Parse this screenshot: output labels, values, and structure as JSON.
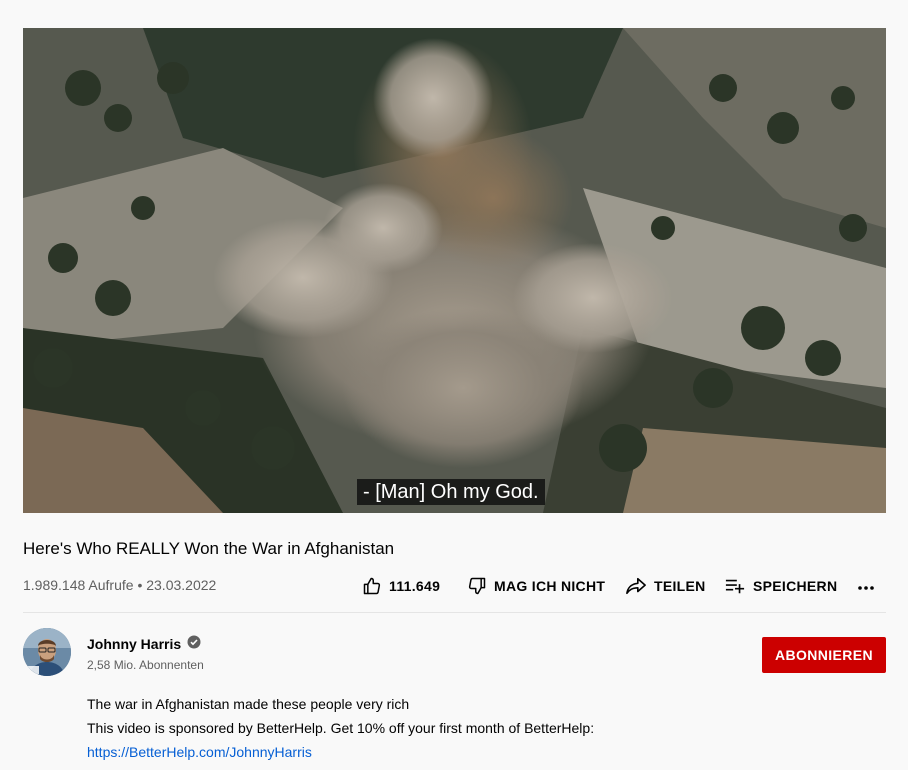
{
  "video": {
    "caption": "- [Man] Oh my God."
  },
  "title": "Here's Who REALLY Won the War in Afghanistan",
  "meta": {
    "views": "1.989.148 Aufrufe",
    "separator": "•",
    "date": "23.03.2022"
  },
  "actions": {
    "like_count": "111.649",
    "dislike_label": "MAG ICH NICHT",
    "share_label": "TEILEN",
    "save_label": "SPEICHERN",
    "more_icon": "more-horizontal-icon"
  },
  "channel": {
    "name": "Johnny Harris",
    "verified_icon": "verified-check-icon",
    "subscribers": "2,58 Mio. Abonnenten",
    "subscribe_label": "ABONNIEREN"
  },
  "description": {
    "line1": "The war in Afghanistan made these people very rich",
    "line2": "This video is sponsored by BetterHelp. Get 10% off your first month of BetterHelp:",
    "link": "https://BetterHelp.com/JohnnyHarris"
  },
  "colors": {
    "subscribe_bg": "#cc0000",
    "link": "#065fd4",
    "secondary_text": "#606060"
  }
}
